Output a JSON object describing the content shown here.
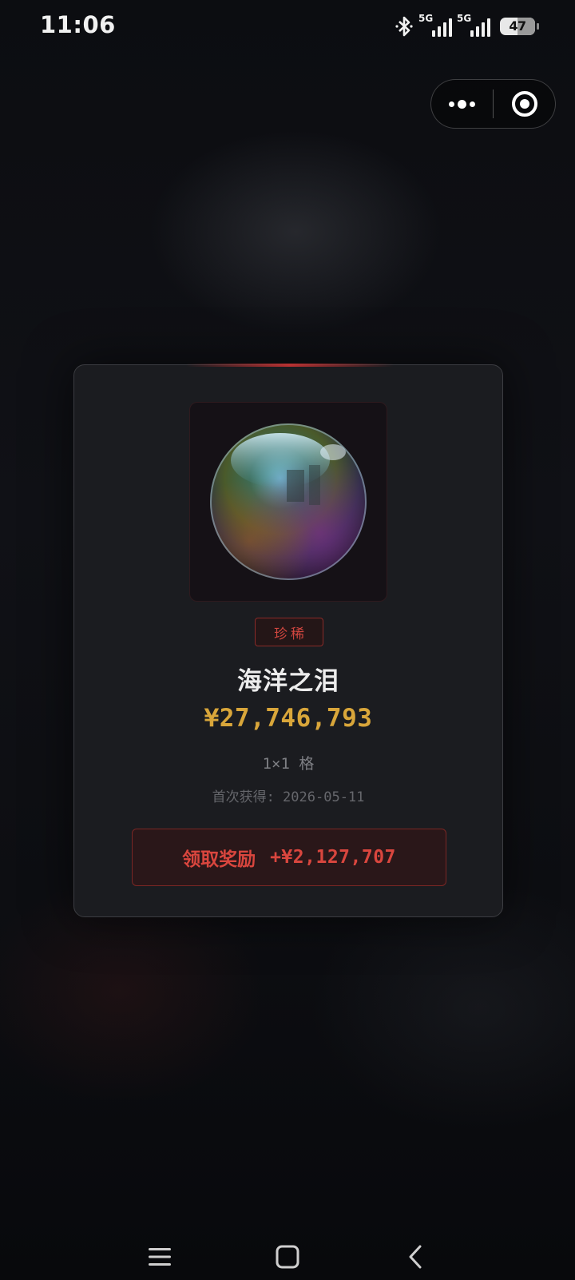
{
  "status_bar": {
    "time": "11:06",
    "network_1": "5G",
    "network_2": "5G",
    "battery": "47"
  },
  "capsule": {
    "more_icon": "more-dots-icon",
    "close_icon": "target-close-icon"
  },
  "card": {
    "image_icon": "ocean-tear-orb",
    "rarity": "珍稀",
    "name": "海洋之泪",
    "price": "¥27,746,793",
    "size": "1×1 格",
    "acquired": "首次获得: 2026-05-11",
    "claim_label": "领取奖励",
    "claim_amount": "+¥2,127,707"
  },
  "colors": {
    "rarity_red": "#d0463f",
    "price_gold": "#d9a63a",
    "card_bg": "#1b1c20"
  },
  "nav_bar": {
    "menu_icon": "menu-icon",
    "home_icon": "home-icon",
    "back_icon": "back-icon"
  }
}
